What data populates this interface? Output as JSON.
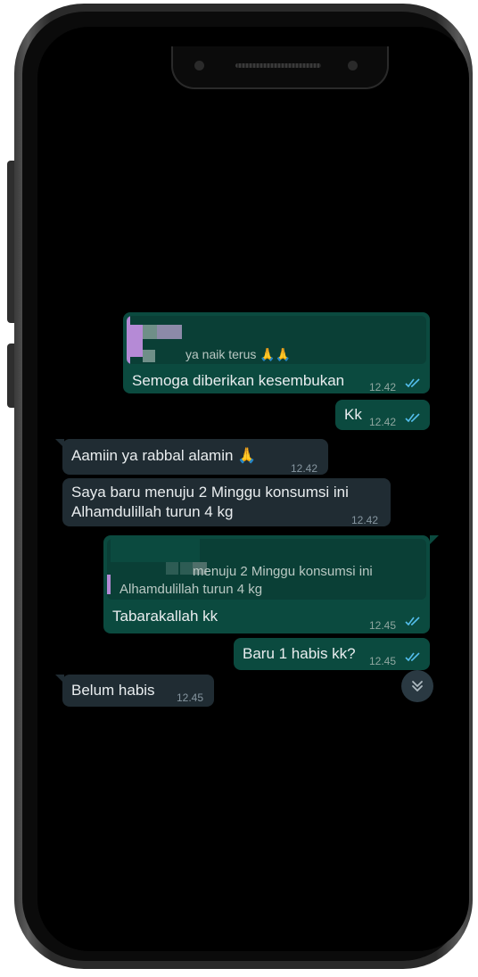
{
  "chat": {
    "messages": [
      {
        "id": "m1",
        "direction": "outgoing",
        "quote_text": "ya naik terus 🙏🙏",
        "text": "Semoga diberikan kesembukan",
        "time": "12.42",
        "status": "read"
      },
      {
        "id": "m2",
        "direction": "outgoing",
        "text": "Kk",
        "time": "12.42",
        "status": "read"
      },
      {
        "id": "m3",
        "direction": "incoming",
        "text": "Aamiin ya rabbal alamin 🙏",
        "time": "12.42"
      },
      {
        "id": "m4",
        "direction": "incoming",
        "text_line1": "Saya baru menuju 2 Minggu konsumsi ini",
        "text_line2": "Alhamdulillah turun 4 kg",
        "time": "12.42"
      },
      {
        "id": "m5",
        "direction": "outgoing",
        "quote_line1": "menuju 2 Minggu konsumsi ini",
        "quote_line2": "Alhamdulillah turun 4 kg",
        "text": "Tabarakallah kk",
        "time": "12.45",
        "status": "read"
      },
      {
        "id": "m6",
        "direction": "outgoing",
        "text": "Baru 1 habis kk?",
        "time": "12.45",
        "status": "read"
      },
      {
        "id": "m7",
        "direction": "incoming",
        "text": "Belum habis",
        "time": "12.45"
      }
    ],
    "scroll_down_icon": "double-chevron-down-icon",
    "colors": {
      "outgoing_bubble": "#0b4a3f",
      "incoming_bubble": "#202c33",
      "read_ticks": "#53bdeb",
      "quote_bar": "#b58ad6",
      "screen_background": "#000000"
    }
  }
}
